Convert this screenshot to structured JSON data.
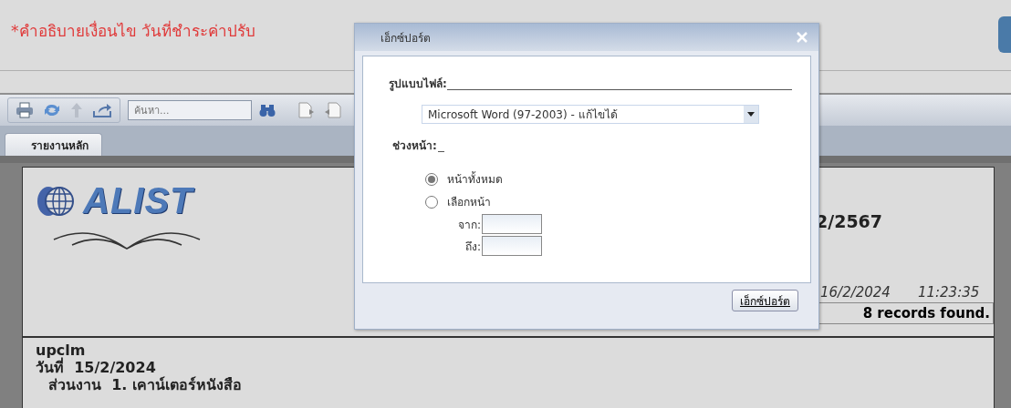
{
  "notice": "*คำอธิบายเงื่อนไข วันที่ชำระค่าปรับ",
  "toolbar": {
    "search": {
      "placeholder": "ค้นหา..."
    }
  },
  "tabs": [
    {
      "label": "รายงานหลัก",
      "selected": true
    }
  ],
  "report": {
    "logo_text": "ALIST",
    "title_fragment": "2/2567",
    "print_date": "16/2/2024",
    "print_time": "11:23:35",
    "record_count": "8 records found.",
    "owner": "upclm",
    "date_line": "วันที่  15/2/2024",
    "section_line": "ส่วนงาน  1. เคาน์เตอร์หนังสือ"
  },
  "dialog": {
    "title": "เอ็กซ์ปอร์ต",
    "file_format_label": "รูปแบบไฟล์:",
    "file_format": "Microsoft Word (97-2003) - แก้ไขได้",
    "page_range_label": "ช่วงหน้า:",
    "range_options": [
      {
        "label": "หน้าทั้งหมด",
        "selected": true
      },
      {
        "label": "เลือกหน้า",
        "selected": false
      }
    ],
    "from_label": "จาก:",
    "to_label": "ถึง:",
    "export_button": "เอ็กซ์ปอร์ต"
  }
}
